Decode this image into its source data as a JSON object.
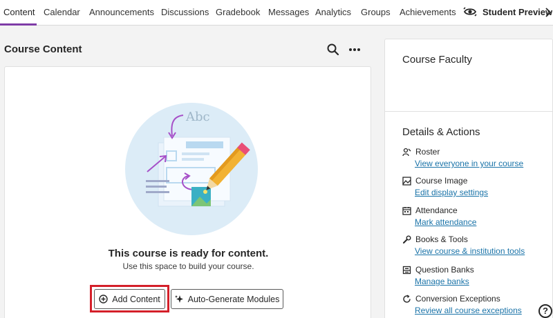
{
  "nav": {
    "tabs": [
      {
        "label": "Content"
      },
      {
        "label": "Calendar"
      },
      {
        "label": "Announcements"
      },
      {
        "label": "Discussions"
      },
      {
        "label": "Gradebook"
      },
      {
        "label": "Messages"
      },
      {
        "label": "Analytics"
      },
      {
        "label": "Groups"
      },
      {
        "label": "Achievements"
      }
    ],
    "active_tab": "Content",
    "student_preview": "Student Preview"
  },
  "course_content": {
    "title": "Course Content",
    "empty_title": "This course is ready for content.",
    "empty_subtitle": "Use this space to build your course.",
    "add_content": "Add Content",
    "auto_generate": "Auto-Generate Modules",
    "illustration_text": "Abc"
  },
  "sidebar": {
    "faculty_title": "Course Faculty",
    "details_title": "Details & Actions",
    "actions": [
      {
        "label": "Roster",
        "link": "View everyone in your course",
        "icon": "roster-icon"
      },
      {
        "label": "Course Image",
        "link": "Edit display settings",
        "icon": "image-icon"
      },
      {
        "label": "Attendance",
        "link": "Mark attendance",
        "icon": "calendar-icon"
      },
      {
        "label": "Books & Tools",
        "link": "View course & institution tools",
        "icon": "wrench-icon"
      },
      {
        "label": "Question Banks",
        "link": "Manage banks",
        "icon": "bank-icon"
      },
      {
        "label": "Conversion Exceptions",
        "link": "Review all course exceptions",
        "icon": "refresh-icon"
      }
    ]
  },
  "help": "?",
  "colors": {
    "accent": "#7e3ba6",
    "link": "#1a73a8",
    "highlight": "#d41f29"
  }
}
